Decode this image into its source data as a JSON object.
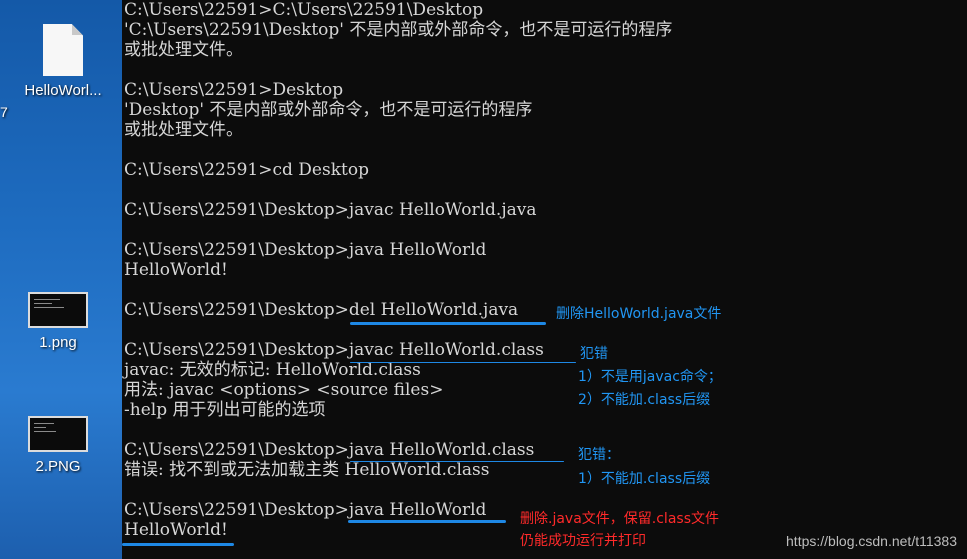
{
  "desktop": {
    "icons": [
      {
        "label": "HelloWorl..."
      },
      {
        "label": "1.png"
      },
      {
        "label": "2.PNG"
      }
    ],
    "edge_digit": "7"
  },
  "terminal": {
    "lines": [
      "C:\\Users\\22591>C:\\Users\\22591\\Desktop",
      "'C:\\Users\\22591\\Desktop' 不是内部或外部命令，也不是可运行的程序",
      "或批处理文件。",
      "",
      "C:\\Users\\22591>Desktop",
      "'Desktop' 不是内部或外部命令，也不是可运行的程序",
      "或批处理文件。",
      "",
      "C:\\Users\\22591>cd Desktop",
      "",
      "C:\\Users\\22591\\Desktop>javac HelloWorld.java",
      "",
      "C:\\Users\\22591\\Desktop>java HelloWorld",
      "HelloWorld!",
      "",
      "C:\\Users\\22591\\Desktop>del HelloWorld.java",
      "",
      "C:\\Users\\22591\\Desktop>javac HelloWorld.class",
      "javac: 无效的标记: HelloWorld.class",
      "用法: javac <options> <source files>",
      "-help 用于列出可能的选项",
      "",
      "C:\\Users\\22591\\Desktop>java HelloWorld.class",
      "错误: 找不到或无法加载主类 HelloWorld.class",
      "",
      "C:\\Users\\22591\\Desktop>java HelloWorld",
      "HelloWorld!"
    ]
  },
  "annotations": {
    "del_note": "删除HelloWorld.java文件",
    "err1_title": "犯错",
    "err1_item1": "1）不是用javac命令；",
    "err1_item2": "2）不能加.class后缀",
    "err2_title": "犯错：",
    "err2_item1": "1）不能加.class后缀",
    "final_note1": "删除.java文件，保留.class文件",
    "final_note2": "仍能成功运行并打印"
  },
  "watermark": "https://blog.csdn.net/t11383",
  "colors": {
    "annotation_blue": "#2196f3",
    "annotation_red": "#ff2a2a",
    "terminal_bg": "#0c0c0c"
  }
}
